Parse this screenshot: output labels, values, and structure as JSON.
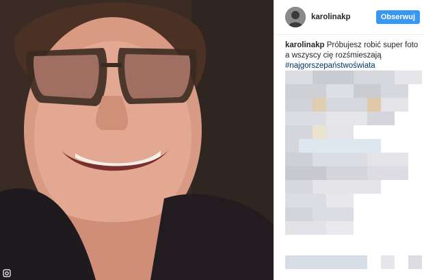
{
  "post": {
    "username": "karolinakp",
    "follow_label": "Obserwuj",
    "caption": "Próbujesz robić super foto a wszyscy cię rozśmieszają",
    "hashtag": "#najgorszepaństwoświata"
  },
  "icons": {
    "avatar": "avatar",
    "camera": "camera-icon"
  },
  "colors": {
    "follow_button": "#3897f0",
    "hashtag": "#003569",
    "username": "#262626"
  }
}
